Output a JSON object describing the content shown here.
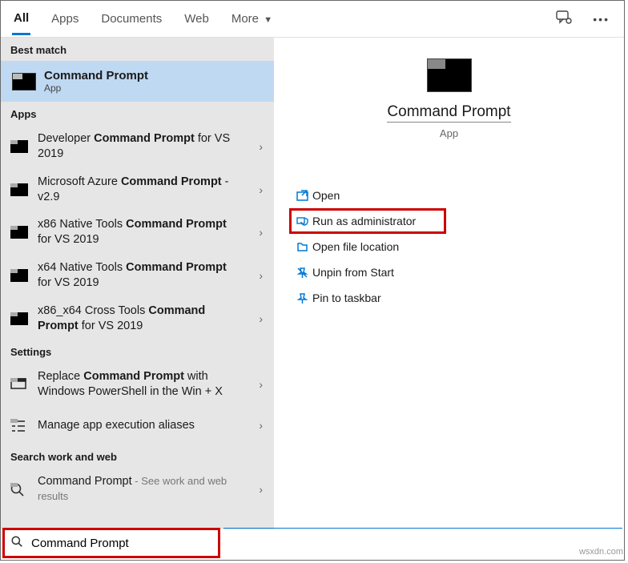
{
  "tabs": {
    "all": "All",
    "apps": "Apps",
    "documents": "Documents",
    "web": "Web",
    "more": "More"
  },
  "sections": {
    "best_match": "Best match",
    "apps": "Apps",
    "settings": "Settings",
    "search_work_web": "Search work and web"
  },
  "best_match": {
    "title": "Command Prompt",
    "subtitle": "App"
  },
  "apps_list": [
    {
      "pre": "Developer ",
      "bold": "Command Prompt",
      "post": " for VS 2019"
    },
    {
      "pre": "Microsoft Azure ",
      "bold": "Command Prompt",
      "post": " - v2.9"
    },
    {
      "pre": "x86 Native Tools ",
      "bold": "Command Prompt",
      "post": " for VS 2019"
    },
    {
      "pre": "x64 Native Tools ",
      "bold": "Command Prompt",
      "post": " for VS 2019"
    },
    {
      "pre": "x86_x64 Cross Tools ",
      "bold": "Command Prompt",
      "post": " for VS 2019"
    }
  ],
  "settings_list": [
    {
      "pre": "Replace ",
      "bold": "Command Prompt",
      "post": " with Windows PowerShell in the Win + X"
    },
    {
      "pre": "Manage app execution aliases",
      "bold": "",
      "post": ""
    }
  ],
  "web_list": {
    "label": "Command Prompt",
    "hint": " - See work and web results"
  },
  "preview": {
    "name": "Command Prompt",
    "type": "App"
  },
  "actions": {
    "open": "Open",
    "run_admin": "Run as administrator",
    "open_location": "Open file location",
    "unpin_start": "Unpin from Start",
    "pin_taskbar": "Pin to taskbar"
  },
  "search": {
    "value": "Command Prompt"
  },
  "watermark": "wsxdn.com",
  "icons": {
    "feedback": "feedback-icon",
    "more": "more-icon"
  }
}
